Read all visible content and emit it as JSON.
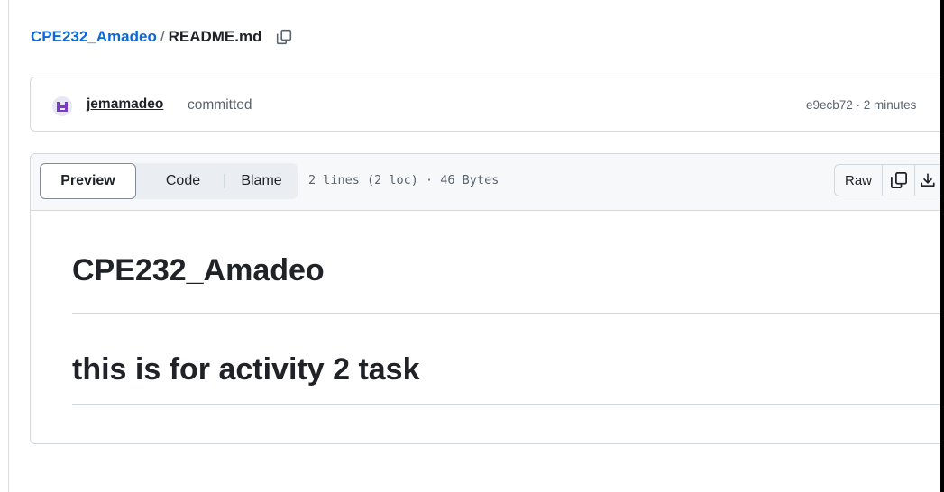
{
  "breadcrumb": {
    "repo": "CPE232_Amadeo",
    "separator": "/",
    "file": "README.md"
  },
  "commit": {
    "author": "jemamadeo",
    "action": "committed",
    "meta": "e9ecb72 · 2 minutes"
  },
  "file_header": {
    "tabs": [
      {
        "label": "Preview",
        "selected": true
      },
      {
        "label": "Code",
        "selected": false
      },
      {
        "label": "Blame",
        "selected": false
      }
    ],
    "info": "2 lines (2 loc) · 46 Bytes",
    "raw_label": "Raw"
  },
  "content": {
    "heading_1": "CPE232_Amadeo",
    "heading_2": "this is for activity 2 task"
  },
  "icons": {
    "breadcrumb_copy": "copy-icon",
    "avatar": "avatar-icon",
    "copy_raw": "copy-icon",
    "download": "download-icon"
  },
  "colors": {
    "link": "#0969da",
    "text": "#1f2328",
    "muted": "#59636e",
    "border": "#d1d9e0",
    "avatar_accent": "#7a3cc8"
  }
}
